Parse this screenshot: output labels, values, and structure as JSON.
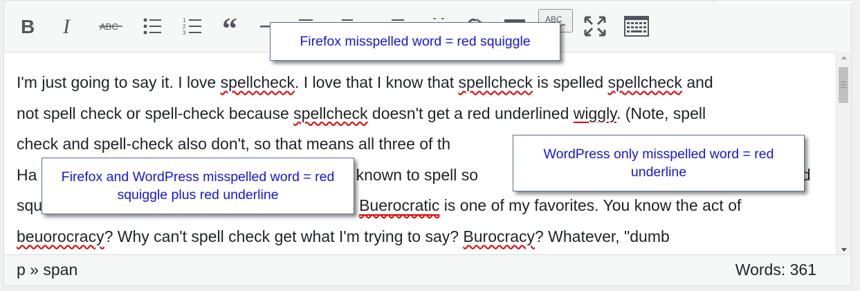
{
  "toolbar": {
    "buttons": [
      {
        "name": "bold-button",
        "icon": "bold-icon"
      },
      {
        "name": "italic-button",
        "icon": "italic-icon"
      },
      {
        "name": "strikethrough-button",
        "icon": "strikethrough-icon",
        "label": "ABC"
      },
      {
        "name": "bulleted-list-button",
        "icon": "bulleted-list-icon"
      },
      {
        "name": "numbered-list-button",
        "icon": "numbered-list-icon"
      },
      {
        "name": "blockquote-button",
        "icon": "blockquote-icon"
      },
      {
        "name": "horizontal-line-button",
        "icon": "horizontal-line-icon"
      },
      {
        "name": "align-left-button",
        "icon": "align-left-icon"
      },
      {
        "name": "align-center-button",
        "icon": "align-center-icon"
      },
      {
        "name": "align-right-button",
        "icon": "align-right-icon"
      },
      {
        "name": "insert-link-button",
        "icon": "link-icon"
      },
      {
        "name": "remove-link-button",
        "icon": "unlink-icon"
      },
      {
        "name": "read-more-button",
        "icon": "read-more-icon"
      },
      {
        "name": "spellcheck-button",
        "icon": "spellcheck-icon",
        "label": "ABC",
        "active": true
      },
      {
        "name": "fullscreen-button",
        "icon": "fullscreen-icon"
      },
      {
        "name": "toolbar-toggle-button",
        "icon": "keyboard-icon"
      }
    ]
  },
  "content": {
    "l1_a": "I'm just going to say it.  I love ",
    "l1_w1": "spellcheck",
    "l1_b": ".  I love that I know that ",
    "l1_w2": "spellcheck",
    "l1_c": " is spelled ",
    "l1_w3": "spellcheck",
    "l1_d": " and",
    "l2_a": "not spell check or spell-check because ",
    "l2_w1": "spellcheck",
    "l2_b": " doesn't get a red underlined ",
    "l2_w2": "wiggly",
    "l2_c": ".  (Note, spell",
    "l3_a": "check and spell-check also don't, so that means all three of th",
    "l4_a": " Ha",
    "l4_b": "n known to spell so",
    "l4_c": "ed",
    "l5_a": "squ",
    "l5_w1": "Buerocratic",
    "l5_b": " is one of my favorites.  You know the act of",
    "l6_w1": "beuorocracy",
    "l6_a": "?  Why can't spell check get what I'm trying to say?  ",
    "l6_w2": "Burocracy",
    "l6_b": "?  Whatever, \"dumb"
  },
  "statusbar": {
    "path": "p » span",
    "words": "Words: 361"
  },
  "callouts": {
    "firefox": "Firefox misspelled word = red squiggle",
    "wordpress": "WordPress only misspelled word = red underline",
    "both": "Firefox and WordPress misspelled word = red squiggle plus red underline"
  },
  "colors": {
    "squiggle": "#e00000",
    "callout_text": "#1515d8"
  }
}
